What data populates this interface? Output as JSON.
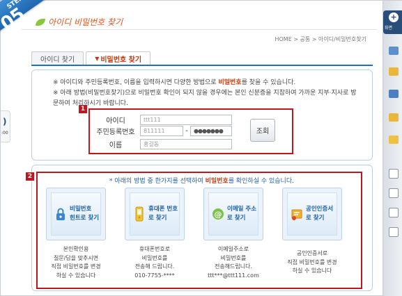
{
  "step": {
    "label": "STEP",
    "number": "05"
  },
  "page_title": "아이디 비밀번호 찾기",
  "breadcrumb": "HOME > 공통 > 아이디/비밀번호찾기",
  "tabs": [
    {
      "label": "아이디 찾기",
      "active": false
    },
    {
      "label": "비밀번호 찾기",
      "active": true,
      "arrow": "▼"
    }
  ],
  "notice": {
    "line1_pre": "※ 아이디와 주민등록번호, 이름을 입력하시면 다양한 방법으로 ",
    "line1_em": "비밀번호",
    "line1_post": "를 찾을 수 있습니다.",
    "line2": "※ 아래 방법(비밀번호찾기)으로 비밀번호 확인이 되지 않을 경우에는 본인 신분증을 지참하여 가까운 지부·지사로 방문하여 처리하시기 바랍니다."
  },
  "badges": {
    "one": "1",
    "two": "2"
  },
  "form": {
    "id_label": "아이디",
    "id_value": "ttt111",
    "rrn_label": "주민등록번호",
    "rrn_front": "811111",
    "rrn_dash": "-",
    "rrn_back": "●●●●●●●",
    "name_label": "이름",
    "name_value": "홍길동",
    "submit": "조회"
  },
  "instruction": {
    "pre": "* 아래의 방법 중 한가지를 선택하여 ",
    "em": "비밀번호",
    "post": "를 확인하실 수 있습니다."
  },
  "methods": [
    {
      "label1": "비밀번호",
      "label2": "힌트로 찾기",
      "icon": "lock-icon",
      "desc": [
        "본인확인용",
        "질문/답을 맞추시면",
        "직접 비밀번호를 변경",
        "하실 수 있습니다"
      ]
    },
    {
      "label1": "휴대폰 번호",
      "label2": "로 찾기",
      "icon": "mobile-phone-icon",
      "desc": [
        "휴대폰번호로",
        "비밀번호를",
        "전송해 드립니다.",
        "010-7755-****"
      ]
    },
    {
      "label1": "이메일 주소",
      "label2": "로 찾기",
      "icon": "email-at-icon",
      "desc": [
        "이메일주소로",
        "비밀번호를",
        "전송해드립니다.",
        "ttt***@ttt111.com"
      ]
    },
    {
      "label1": "공인인증서",
      "label2": "로 찾기",
      "icon": "certificate-icon",
      "desc": [
        "공인인증서로",
        "직접 비밀번호를 변경",
        "하실 수 있습니다"
      ]
    }
  ],
  "sidebar": {
    "top_label": "화면"
  },
  "left_tab": {
    "symbol": ")",
    "text": ":00"
  },
  "colors": {
    "accent_red": "#c2161e",
    "brand_blue": "#1e6fbf",
    "title_orange": "#e8541c"
  }
}
